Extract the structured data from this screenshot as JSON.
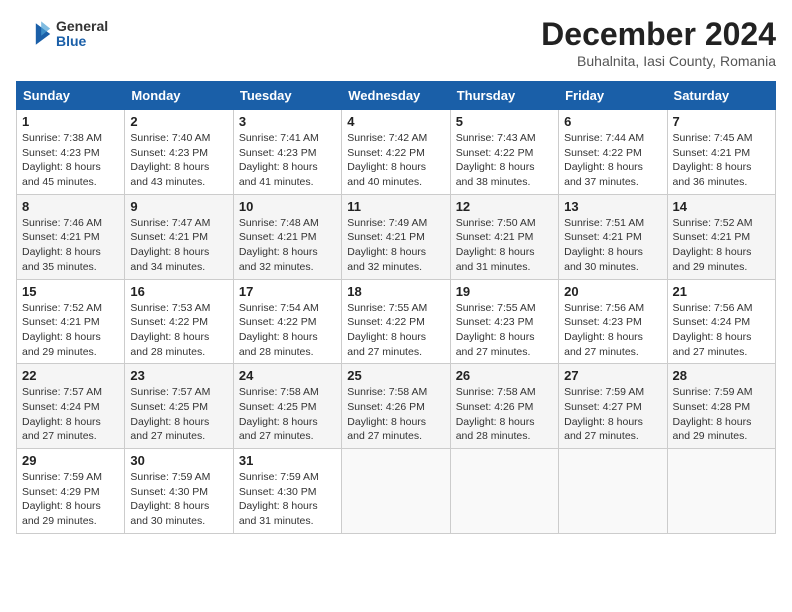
{
  "header": {
    "logo_general": "General",
    "logo_blue": "Blue",
    "month_title": "December 2024",
    "subtitle": "Buhalnita, Iasi County, Romania"
  },
  "days_of_week": [
    "Sunday",
    "Monday",
    "Tuesday",
    "Wednesday",
    "Thursday",
    "Friday",
    "Saturday"
  ],
  "weeks": [
    [
      {
        "day": 1,
        "sunrise": "7:38 AM",
        "sunset": "4:23 PM",
        "daylight": "8 hours and 45 minutes."
      },
      {
        "day": 2,
        "sunrise": "7:40 AM",
        "sunset": "4:23 PM",
        "daylight": "8 hours and 43 minutes."
      },
      {
        "day": 3,
        "sunrise": "7:41 AM",
        "sunset": "4:23 PM",
        "daylight": "8 hours and 41 minutes."
      },
      {
        "day": 4,
        "sunrise": "7:42 AM",
        "sunset": "4:22 PM",
        "daylight": "8 hours and 40 minutes."
      },
      {
        "day": 5,
        "sunrise": "7:43 AM",
        "sunset": "4:22 PM",
        "daylight": "8 hours and 38 minutes."
      },
      {
        "day": 6,
        "sunrise": "7:44 AM",
        "sunset": "4:22 PM",
        "daylight": "8 hours and 37 minutes."
      },
      {
        "day": 7,
        "sunrise": "7:45 AM",
        "sunset": "4:21 PM",
        "daylight": "8 hours and 36 minutes."
      }
    ],
    [
      {
        "day": 8,
        "sunrise": "7:46 AM",
        "sunset": "4:21 PM",
        "daylight": "8 hours and 35 minutes."
      },
      {
        "day": 9,
        "sunrise": "7:47 AM",
        "sunset": "4:21 PM",
        "daylight": "8 hours and 34 minutes."
      },
      {
        "day": 10,
        "sunrise": "7:48 AM",
        "sunset": "4:21 PM",
        "daylight": "8 hours and 32 minutes."
      },
      {
        "day": 11,
        "sunrise": "7:49 AM",
        "sunset": "4:21 PM",
        "daylight": "8 hours and 32 minutes."
      },
      {
        "day": 12,
        "sunrise": "7:50 AM",
        "sunset": "4:21 PM",
        "daylight": "8 hours and 31 minutes."
      },
      {
        "day": 13,
        "sunrise": "7:51 AM",
        "sunset": "4:21 PM",
        "daylight": "8 hours and 30 minutes."
      },
      {
        "day": 14,
        "sunrise": "7:52 AM",
        "sunset": "4:21 PM",
        "daylight": "8 hours and 29 minutes."
      }
    ],
    [
      {
        "day": 15,
        "sunrise": "7:52 AM",
        "sunset": "4:21 PM",
        "daylight": "8 hours and 29 minutes."
      },
      {
        "day": 16,
        "sunrise": "7:53 AM",
        "sunset": "4:22 PM",
        "daylight": "8 hours and 28 minutes."
      },
      {
        "day": 17,
        "sunrise": "7:54 AM",
        "sunset": "4:22 PM",
        "daylight": "8 hours and 28 minutes."
      },
      {
        "day": 18,
        "sunrise": "7:55 AM",
        "sunset": "4:22 PM",
        "daylight": "8 hours and 27 minutes."
      },
      {
        "day": 19,
        "sunrise": "7:55 AM",
        "sunset": "4:23 PM",
        "daylight": "8 hours and 27 minutes."
      },
      {
        "day": 20,
        "sunrise": "7:56 AM",
        "sunset": "4:23 PM",
        "daylight": "8 hours and 27 minutes."
      },
      {
        "day": 21,
        "sunrise": "7:56 AM",
        "sunset": "4:24 PM",
        "daylight": "8 hours and 27 minutes."
      }
    ],
    [
      {
        "day": 22,
        "sunrise": "7:57 AM",
        "sunset": "4:24 PM",
        "daylight": "8 hours and 27 minutes."
      },
      {
        "day": 23,
        "sunrise": "7:57 AM",
        "sunset": "4:25 PM",
        "daylight": "8 hours and 27 minutes."
      },
      {
        "day": 24,
        "sunrise": "7:58 AM",
        "sunset": "4:25 PM",
        "daylight": "8 hours and 27 minutes."
      },
      {
        "day": 25,
        "sunrise": "7:58 AM",
        "sunset": "4:26 PM",
        "daylight": "8 hours and 27 minutes."
      },
      {
        "day": 26,
        "sunrise": "7:58 AM",
        "sunset": "4:26 PM",
        "daylight": "8 hours and 28 minutes."
      },
      {
        "day": 27,
        "sunrise": "7:59 AM",
        "sunset": "4:27 PM",
        "daylight": "8 hours and 27 minutes."
      },
      {
        "day": 28,
        "sunrise": "7:59 AM",
        "sunset": "4:28 PM",
        "daylight": "8 hours and 29 minutes."
      }
    ],
    [
      {
        "day": 29,
        "sunrise": "7:59 AM",
        "sunset": "4:29 PM",
        "daylight": "8 hours and 29 minutes."
      },
      {
        "day": 30,
        "sunrise": "7:59 AM",
        "sunset": "4:30 PM",
        "daylight": "8 hours and 30 minutes."
      },
      {
        "day": 31,
        "sunrise": "7:59 AM",
        "sunset": "4:30 PM",
        "daylight": "8 hours and 31 minutes."
      },
      null,
      null,
      null,
      null
    ]
  ],
  "labels": {
    "sunrise": "Sunrise:",
    "sunset": "Sunset:",
    "daylight": "Daylight:"
  }
}
